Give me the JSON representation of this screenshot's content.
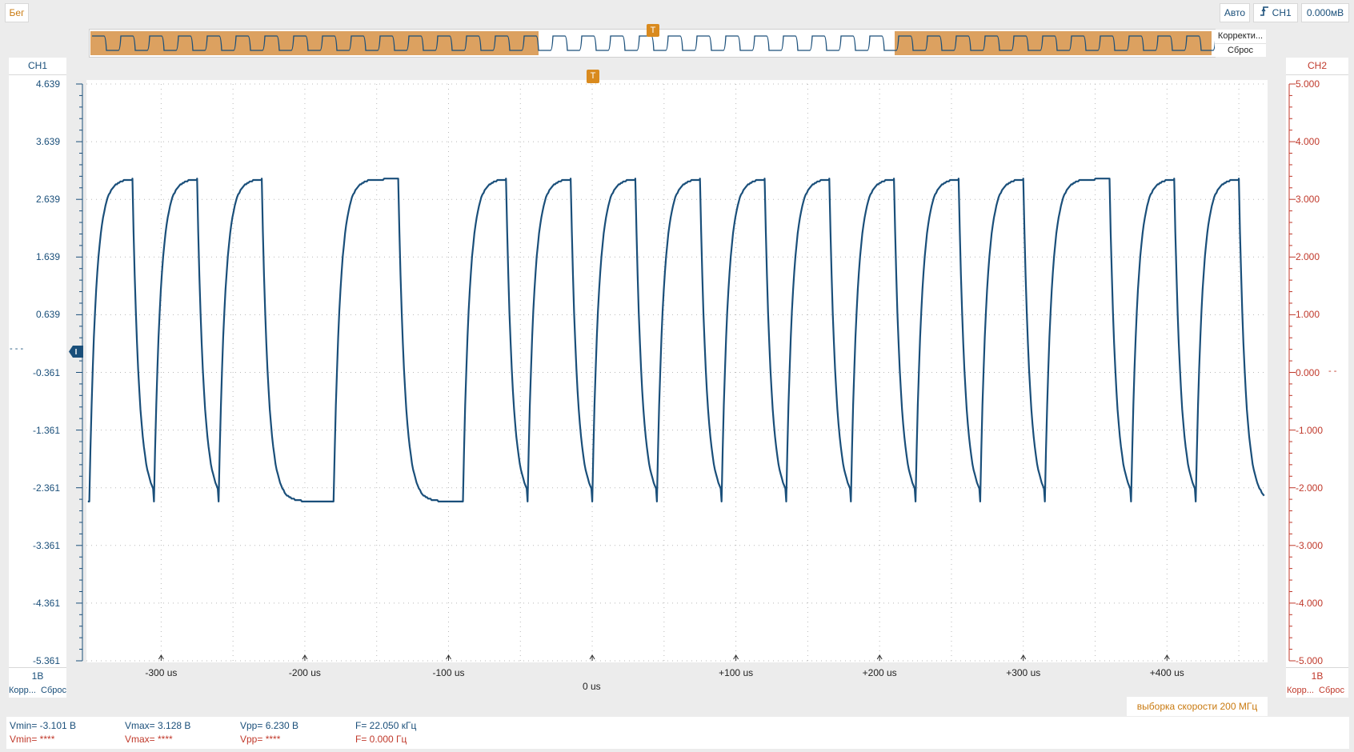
{
  "toolbar": {
    "run_label": "Бег",
    "mode_label": "Авто",
    "trigger_channel": "CH1",
    "trigger_level": "0.000мВ"
  },
  "overview": {
    "adjust_label": "Корректи...",
    "reset_label": "Сброс",
    "trigger_marker": "T"
  },
  "ch1": {
    "name": "CH1",
    "scale": "1В",
    "ticks": [
      "4.639",
      "3.639",
      "2.639",
      "1.639",
      "0.639",
      "-0.361",
      "-1.361",
      "-2.361",
      "-3.361",
      "-4.361",
      "-5.361"
    ],
    "ground_marker": "- - -",
    "adjust_label": "Корр...",
    "reset_label": "Сброс",
    "color": "#1a4f7a"
  },
  "ch2": {
    "name": "CH2",
    "scale": "1В",
    "ticks": [
      "5.000",
      "4.000",
      "3.000",
      "2.000",
      "1.000",
      "0.000",
      "-1.000",
      "-2.000",
      "-3.000",
      "-4.000",
      "-5.000"
    ],
    "ground_marker": "- -",
    "adjust_label": "Корр...",
    "reset_label": "Сброс",
    "color": "#c0392b"
  },
  "time_axis": {
    "ticks": [
      "-300 us",
      "-200 us",
      "-100 us",
      "0 us",
      "+100 us",
      "+200 us",
      "+300 us",
      "+400 us"
    ],
    "zero_label": "0 us"
  },
  "trigger_marker": "T",
  "sample_rate": "выборка скорости 200 МГц",
  "measurements": {
    "ch1": {
      "vmin": "Vmin= -3.101 В",
      "vmax": "Vmax= 3.128 В",
      "vpp": "Vpp= 6.230 В",
      "freq": "F= 22.050 кГц"
    },
    "ch2": {
      "vmin": "Vmin= ****",
      "vmax": "Vmax= ****",
      "vpp": "Vpp= ****",
      "freq": "F= 0.000 Гц"
    }
  },
  "chart_data": {
    "type": "line",
    "x_unit": "us",
    "xlim": [
      -352,
      470
    ],
    "ylim": [
      -5.361,
      4.639
    ],
    "series": [
      {
        "name": "CH1",
        "color": "#1a4f7a",
        "high": 2.99,
        "low": -2.6,
        "rise_times": [
          -350,
          -305,
          -260,
          -180,
          -135,
          -90,
          -45,
          0,
          45,
          90,
          135,
          180,
          225,
          270,
          315,
          375,
          420
        ],
        "fall_times": [
          -320,
          -275,
          -230,
          -135,
          -105,
          -60,
          -15,
          30,
          75,
          120,
          165,
          210,
          255,
          300,
          360,
          405,
          450
        ]
      }
    ]
  }
}
